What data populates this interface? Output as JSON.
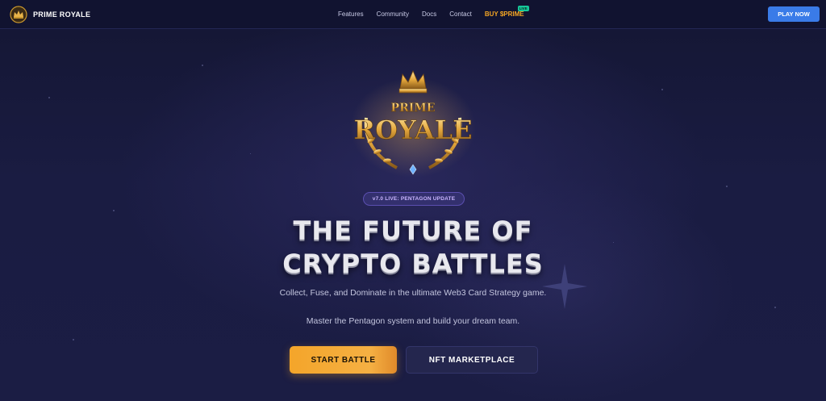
{
  "header": {
    "brand_name": "PRIME ROYALE",
    "nav": [
      "Features",
      "Community",
      "Docs",
      "Contact"
    ],
    "buy_label": "BUY $PRIME",
    "buy_badge": "LIVE",
    "play_now": "PLAY NOW"
  },
  "hero": {
    "logo_top": "PRIME",
    "logo_main": "ROYALE",
    "version_pill": "v7.0 LIVE: PENTAGON UPDATE",
    "headline_line1": "THE FUTURE OF",
    "headline_line2": "CRYPTO BATTLES",
    "subtitle_line1": "Collect, Fuse, and Dominate in the ultimate Web3 Card Strategy game.",
    "subtitle_line2": "Master the Pentagon system and build your dream team.",
    "cta_primary": "START BATTLE",
    "cta_secondary": "NFT MARKETPLACE"
  },
  "colors": {
    "background": "#17193a",
    "accent_gold": "#f5a623",
    "accent_blue": "#3a7be8",
    "pill_purple": "#33306e"
  }
}
